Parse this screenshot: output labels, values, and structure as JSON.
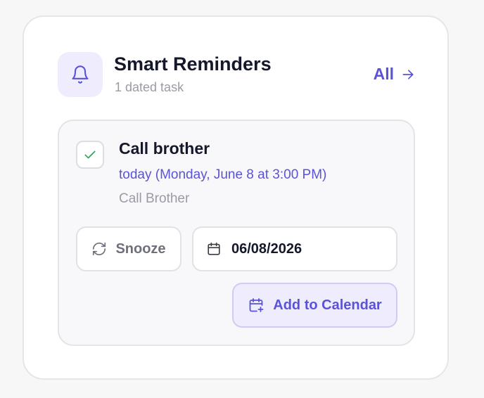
{
  "header": {
    "title": "Smart Reminders",
    "subtitle": "1 dated task",
    "all_label": "All",
    "icon": "bell-icon"
  },
  "task": {
    "title": "Call brother",
    "when": "today (Monday, June 8 at 3:00 PM)",
    "note": "Call Brother",
    "completed": true,
    "snooze_label": "Snooze",
    "date_value": "06/08/2026",
    "add_calendar_label": "Add to Calendar"
  },
  "colors": {
    "accent": "#5b53d6",
    "accent_bg": "#eeecfd",
    "check": "#2f9e5a",
    "text": "#15182a",
    "muted": "#9a9ba5"
  }
}
